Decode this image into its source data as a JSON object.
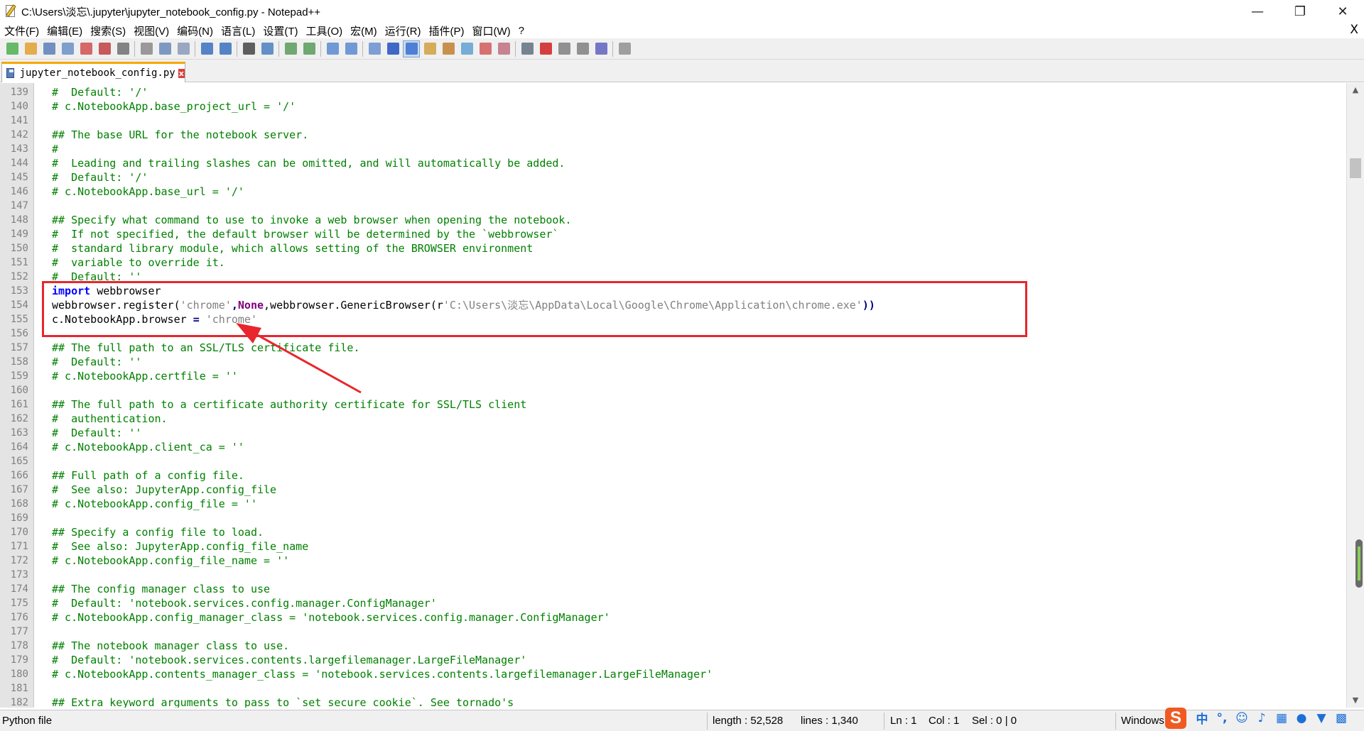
{
  "window": {
    "title": "C:\\Users\\淡忘\\.jupyter\\jupyter_notebook_config.py - Notepad++",
    "minimize": "—",
    "restore": "❐",
    "close": "✕"
  },
  "menu": {
    "items": [
      "文件(F)",
      "编辑(E)",
      "搜索(S)",
      "视图(V)",
      "编码(N)",
      "语言(L)",
      "设置(T)",
      "工具(O)",
      "宏(M)",
      "运行(R)",
      "插件(P)",
      "窗口(W)",
      "?"
    ],
    "close": "X"
  },
  "tab": {
    "label": "jupyter_notebook_config.py",
    "close": "x"
  },
  "editor": {
    "lines": [
      {
        "n": "139",
        "text": "#  Default: '/'"
      },
      {
        "n": "140",
        "text": "# c.NotebookApp.base_project_url = '/'"
      },
      {
        "n": "141",
        "text": ""
      },
      {
        "n": "142",
        "text": "## The base URL for the notebook server."
      },
      {
        "n": "143",
        "text": "#"
      },
      {
        "n": "144",
        "text": "#  Leading and trailing slashes can be omitted, and will automatically be added."
      },
      {
        "n": "145",
        "text": "#  Default: '/'"
      },
      {
        "n": "146",
        "text": "# c.NotebookApp.base_url = '/'"
      },
      {
        "n": "147",
        "text": ""
      },
      {
        "n": "148",
        "text": "## Specify what command to use to invoke a web browser when opening the notebook."
      },
      {
        "n": "149",
        "text": "#  If not specified, the default browser will be determined by the `webbrowser`"
      },
      {
        "n": "150",
        "text": "#  standard library module, which allows setting of the BROWSER environment"
      },
      {
        "n": "151",
        "text": "#  variable to override it."
      },
      {
        "n": "152",
        "text": "#  Default: ''"
      },
      {
        "n": "153",
        "text": "import webbrowser"
      },
      {
        "n": "154",
        "text": "webbrowser.register('chrome',None,webbrowser.GenericBrowser(r'C:\\Users\\淡忘\\AppData\\Local\\Google\\Chrome\\Application\\chrome.exe'))"
      },
      {
        "n": "155",
        "text": "c.NotebookApp.browser = 'chrome'"
      },
      {
        "n": "156",
        "text": ""
      },
      {
        "n": "157",
        "text": "## The full path to an SSL/TLS certificate file."
      },
      {
        "n": "158",
        "text": "#  Default: ''"
      },
      {
        "n": "159",
        "text": "# c.NotebookApp.certfile = ''"
      },
      {
        "n": "160",
        "text": ""
      },
      {
        "n": "161",
        "text": "## The full path to a certificate authority certificate for SSL/TLS client"
      },
      {
        "n": "162",
        "text": "#  authentication."
      },
      {
        "n": "163",
        "text": "#  Default: ''"
      },
      {
        "n": "164",
        "text": "# c.NotebookApp.client_ca = ''"
      },
      {
        "n": "165",
        "text": ""
      },
      {
        "n": "166",
        "text": "## Full path of a config file."
      },
      {
        "n": "167",
        "text": "#  See also: JupyterApp.config_file"
      },
      {
        "n": "168",
        "text": "# c.NotebookApp.config_file = ''"
      },
      {
        "n": "169",
        "text": ""
      },
      {
        "n": "170",
        "text": "## Specify a config file to load."
      },
      {
        "n": "171",
        "text": "#  See also: JupyterApp.config_file_name"
      },
      {
        "n": "172",
        "text": "# c.NotebookApp.config_file_name = ''"
      },
      {
        "n": "173",
        "text": ""
      },
      {
        "n": "174",
        "text": "## The config manager class to use"
      },
      {
        "n": "175",
        "text": "#  Default: 'notebook.services.config.manager.ConfigManager'"
      },
      {
        "n": "176",
        "text": "# c.NotebookApp.config_manager_class = 'notebook.services.config.manager.ConfigManager'"
      },
      {
        "n": "177",
        "text": ""
      },
      {
        "n": "178",
        "text": "## The notebook manager class to use."
      },
      {
        "n": "179",
        "text": "#  Default: 'notebook.services.contents.largefilemanager.LargeFileManager'"
      },
      {
        "n": "180",
        "text": "# c.NotebookApp.contents_manager_class = 'notebook.services.contents.largefilemanager.LargeFileManager'"
      },
      {
        "n": "181",
        "text": ""
      },
      {
        "n": "182",
        "text": "## Extra keyword arguments to pass to `set_secure_cookie`. See tornado's"
      }
    ],
    "code_parts": {
      "kw_import": "import",
      "mod_name": " webbrowser",
      "reg_call": "webbrowser.register(",
      "str_chrome": "'chrome'",
      "comma1": ",",
      "kw_none": "None",
      "mid": ",webbrowser.GenericBrowser(",
      "raw_prefix": "r",
      "str_path": "'C:\\Users\\淡忘\\AppData\\Local\\Google\\Chrome\\Application\\chrome.exe'",
      "close_parens": "))",
      "browser_attr": "c.NotebookApp.browser ",
      "eq": "=",
      "sp": " ",
      "str_chrome2": "'chrome'"
    }
  },
  "status": {
    "file_type": "Python file",
    "length": "length : 52,528",
    "lines": "lines : 1,340",
    "ln": "Ln : 1",
    "col": "Col : 1",
    "sel": "Sel : 0 | 0",
    "eol": "Windows",
    "ime_label": "S",
    "ime_mode": "中",
    "ime_punct": "°,"
  },
  "colors": {
    "comment": "#008000",
    "keyword": "#0000ff",
    "string": "#808080",
    "operator": "#000080",
    "none_kw": "#7f007f",
    "highlight": "#e8262d",
    "tab_accent": "#f7a800"
  },
  "toolbar_icons": [
    "new-file-icon",
    "open-file-icon",
    "save-icon",
    "save-all-icon",
    "close-icon",
    "close-all-icon",
    "print-icon",
    "cut-icon",
    "copy-icon",
    "paste-icon",
    "undo-icon",
    "redo-icon",
    "find-icon",
    "replace-icon",
    "zoom-in-icon",
    "zoom-out-icon",
    "sync-vertical-icon",
    "sync-horizontal-icon",
    "word-wrap-icon",
    "show-all-chars-icon",
    "indent-guide-icon",
    "user-lang-icon",
    "doc-map-icon",
    "function-list-icon",
    "folder-workspace-icon",
    "monitor-icon",
    "record-macro-icon",
    "stop-macro-icon",
    "play-macro-icon",
    "run-macro-multiple-icon",
    "save-macro-icon",
    "plugin-icon"
  ]
}
